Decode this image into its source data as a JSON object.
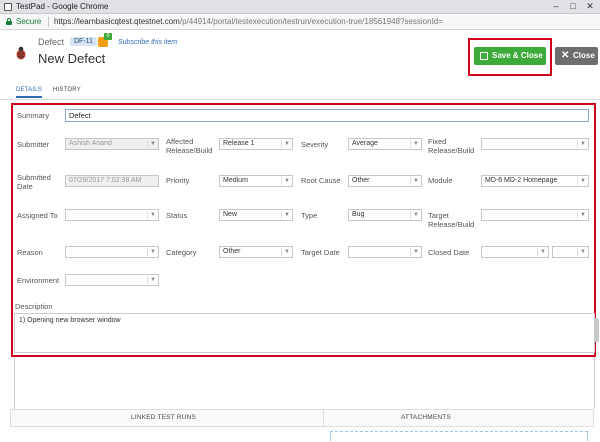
{
  "browser": {
    "window_title": "TestPad - Google Chrome",
    "secure_label": "Secure",
    "url_main": "https://learnbasicqtest.qtestnet.com",
    "url_path": "/p/44914/portal/testexecution/testrun/execution-true/18561948?sessionId="
  },
  "header": {
    "entity_label": "Defect",
    "entity_id": "DF-11",
    "rss_count": "0",
    "subscribe_label": "Subscribe this item",
    "page_title": "New Defect",
    "save_label": "Save & Close",
    "close_label": "Close"
  },
  "tabs": {
    "details": "DETAILS",
    "history": "HISTORY"
  },
  "form": {
    "summary_label": "Summary",
    "summary_value": "Defect",
    "submitter_label": "Submitter",
    "submitter_value": "Ashish Anand",
    "affected_label": "Affected Release/Build",
    "affected_value": "Release 1",
    "severity_label": "Severity",
    "severity_value": "Average",
    "fixed_label": "Fixed Release/Build",
    "fixed_value": "",
    "submitted_date_label": "Submitted Date",
    "submitted_date_value": "07/29/2017 7:02:38 AM",
    "priority_label": "Priority",
    "priority_value": "Medium",
    "root_cause_label": "Root Cause",
    "root_cause_value": "Other",
    "module_label": "Module",
    "module_value": "MD-6 MD-2 Homepage",
    "assigned_label": "Assigned To",
    "assigned_value": "",
    "status_label": "Status",
    "status_value": "New",
    "type_label": "Type",
    "type_value": "Bug",
    "target_release_label": "Target Release/Build",
    "target_release_value": "",
    "reason_label": "Reason",
    "reason_value": "",
    "category_label": "Category",
    "category_value": "Other",
    "target_date_label": "Target Date",
    "target_date_value": "",
    "closed_date_label": "Closed Date",
    "closed_date_value": "",
    "environment_label": "Environment",
    "environment_value": "",
    "description_label": "Description",
    "description_value": "1) Opening new browser window"
  },
  "bottom_tabs": {
    "linked": "LINKED TEST RUNS",
    "attachments": "ATTACHMENTS"
  },
  "colors": {
    "accent": "#2f6db3",
    "save": "#3cab39",
    "highlight": "#d0021b",
    "close": "#6d6d6d"
  }
}
